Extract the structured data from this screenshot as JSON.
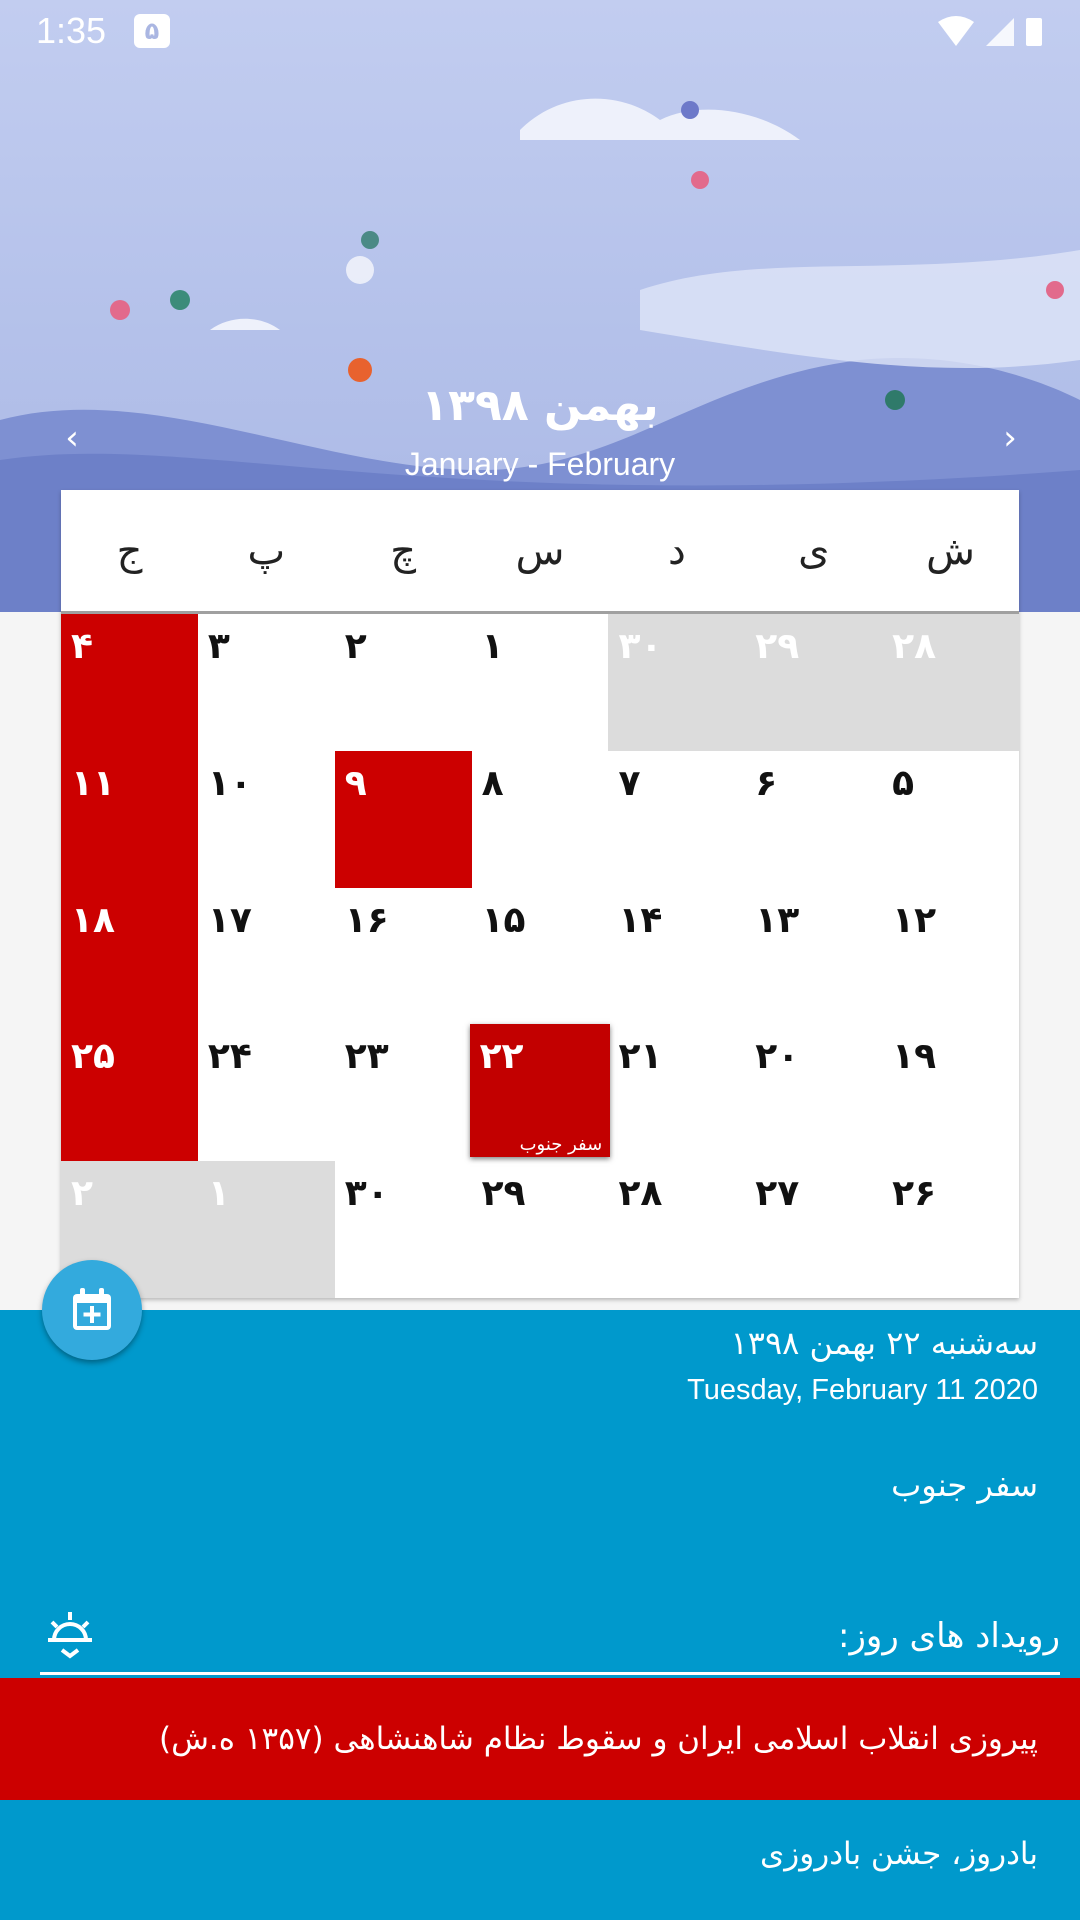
{
  "status": {
    "time": "1:35",
    "notification": "۵"
  },
  "header": {
    "month_title": "بهمن ۱۳۹۸",
    "month_subtitle": "January - February",
    "prev": "‹",
    "next": "›"
  },
  "weekdays": [
    "ش",
    "ی",
    "د",
    "س",
    "چ",
    "پ",
    "ج"
  ],
  "days": [
    {
      "n": "۲۸",
      "type": "other"
    },
    {
      "n": "۲۹",
      "type": "other"
    },
    {
      "n": "۳۰",
      "type": "other"
    },
    {
      "n": "۱",
      "type": "normal"
    },
    {
      "n": "۲",
      "type": "normal"
    },
    {
      "n": "۳",
      "type": "normal"
    },
    {
      "n": "۴",
      "type": "holiday"
    },
    {
      "n": "۵",
      "type": "normal"
    },
    {
      "n": "۶",
      "type": "normal"
    },
    {
      "n": "۷",
      "type": "normal"
    },
    {
      "n": "۸",
      "type": "normal"
    },
    {
      "n": "۹",
      "type": "holiday"
    },
    {
      "n": "۱۰",
      "type": "normal"
    },
    {
      "n": "۱۱",
      "type": "holiday"
    },
    {
      "n": "۱۲",
      "type": "normal"
    },
    {
      "n": "۱۳",
      "type": "normal"
    },
    {
      "n": "۱۴",
      "type": "normal"
    },
    {
      "n": "۱۵",
      "type": "normal"
    },
    {
      "n": "۱۶",
      "type": "normal"
    },
    {
      "n": "۱۷",
      "type": "normal"
    },
    {
      "n": "۱۸",
      "type": "holiday"
    },
    {
      "n": "۱۹",
      "type": "normal"
    },
    {
      "n": "۲۰",
      "type": "normal"
    },
    {
      "n": "۲۱",
      "type": "normal"
    },
    {
      "n": "۲۲",
      "type": "selected",
      "event": "سفر جنوب"
    },
    {
      "n": "۲۳",
      "type": "normal"
    },
    {
      "n": "۲۴",
      "type": "normal"
    },
    {
      "n": "۲۵",
      "type": "holiday"
    },
    {
      "n": "۲۶",
      "type": "normal"
    },
    {
      "n": "۲۷",
      "type": "normal"
    },
    {
      "n": "۲۸",
      "type": "normal"
    },
    {
      "n": "۲۹",
      "type": "normal"
    },
    {
      "n": "۳۰",
      "type": "normal"
    },
    {
      "n": "۱",
      "type": "other"
    },
    {
      "n": "۲",
      "type": "other"
    }
  ],
  "details": {
    "date_fa": "سه‌شنبه  ۲۲  بهمن  ۱۳۹۸",
    "date_en": "Tuesday,  February 11 2020",
    "note": "سفر جنوب",
    "events_title": "رویداد های روز:",
    "holiday_event": "پیروزی انقلاب اسلامی ایران و سقوط نظام شاهنشاهی (۱۳۵۷ ه.ش)",
    "normal_event": "بادروز، جشن بادروزی"
  },
  "colors": {
    "holiday": "#cc0000",
    "panel": "#0099cc",
    "other_month": "#dcdcdc"
  }
}
